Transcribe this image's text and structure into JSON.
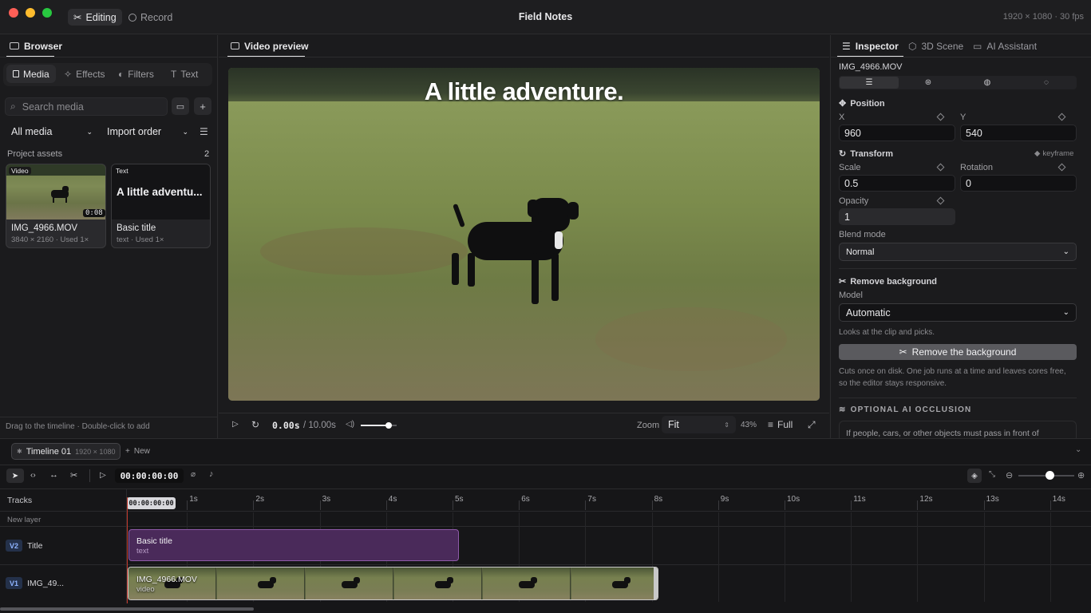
{
  "window": {
    "title": "Field Notes",
    "meta": "1920 × 1080 · 30 fps"
  },
  "modes": [
    {
      "label": "Editing",
      "icon": "scissors-icon"
    },
    {
      "label": "Record",
      "icon": "record-icon"
    }
  ],
  "browser": {
    "title": "Browser",
    "tabs": [
      "Media",
      "Effects",
      "Filters",
      "Text"
    ],
    "search_placeholder": "Search media",
    "filter": "All media",
    "sort": "Import order",
    "assets_label": "Project assets",
    "assets_count": "2",
    "assets": [
      {
        "badge": "Video",
        "duration": "0:08",
        "name": "IMG_4966.MOV",
        "detail": "3840 × 2160 · Used 1×"
      },
      {
        "badge": "Text",
        "preview": "A little adventu...",
        "name": "Basic title",
        "detail": "text · Used 1×"
      }
    ],
    "hint": "Drag to the timeline · Double-click to add"
  },
  "preview": {
    "title": "Video preview",
    "overlay_text": "A little adventure.",
    "time_current": "0.00s",
    "time_total": "/ 10.00s",
    "volume": 0.78,
    "zoom_label": "Zoom",
    "zoom_value": "Fit",
    "zoom_percent": "43%",
    "full_label": "Full"
  },
  "inspector": {
    "tabs": [
      "Inspector",
      "3D Scene",
      "AI Assistant"
    ],
    "clip_name": "IMG_4966.MOV",
    "position_label": "Position",
    "x_label": "X",
    "x_value": "960",
    "y_label": "Y",
    "y_value": "540",
    "transform_label": "Transform",
    "keyframe_label": "keyframe",
    "scale_label": "Scale",
    "scale_value": "0.5",
    "rotation_label": "Rotation",
    "rotation_value": "0",
    "opacity_label": "Opacity",
    "opacity_value": "1",
    "blend_label": "Blend mode",
    "blend_value": "Normal",
    "remove_bg_label": "Remove background",
    "model_label": "Model",
    "model_value": "Automatic",
    "model_hint": "Looks at the clip and picks.",
    "remove_button": "Remove the background",
    "remove_note": "Cuts once on disk. One job runs at a time and leaves cores free, so the editor stays responsive.",
    "occlusion_label": "OPTIONAL AI OCCLUSION",
    "occlusion_text": "If people, cars, or other objects must pass in front of"
  },
  "timeline": {
    "tab_name": "Timeline 01",
    "tab_res": "1920 × 1080",
    "new_label": "New",
    "timecode": "00:00:00:00",
    "zoom_level": 0.55,
    "tracks_label": "Tracks",
    "playhead_label": "00:00:00:00",
    "ruler": [
      "1s",
      "2s",
      "3s",
      "4s",
      "5s",
      "6s",
      "7s",
      "8s",
      "9s",
      "10s",
      "11s",
      "12s",
      "13s",
      "14s"
    ],
    "new_layer": "New layer",
    "tracks": [
      {
        "tag": "V2",
        "name": "Title",
        "clip_name": "Basic title",
        "clip_type": "text"
      },
      {
        "tag": "V1",
        "name": "IMG_49...",
        "clip_name": "IMG_4966.MOV",
        "clip_type": "video"
      }
    ]
  },
  "colors": {
    "accent_purple": "#4a2a5a",
    "clip_border": "#8e5aa8",
    "playhead": "#c0392b"
  }
}
